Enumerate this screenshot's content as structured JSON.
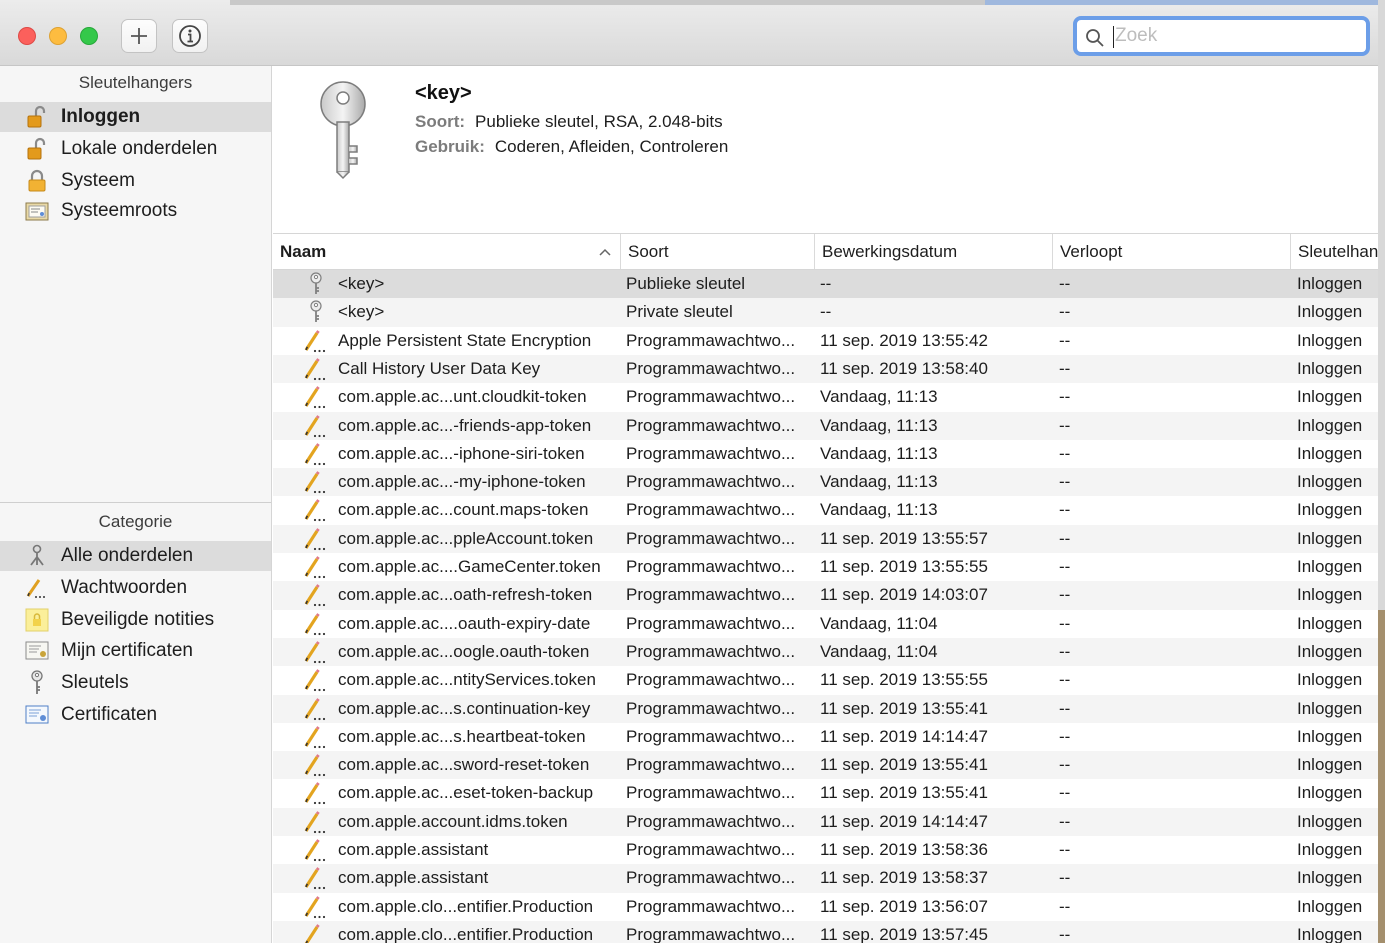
{
  "toolbar": {
    "add_icon": "plus-icon",
    "info_icon": "info-icon",
    "search": {
      "placeholder": "Zoek",
      "value": ""
    }
  },
  "sidebar": {
    "keychains_header": "Sleutelhangers",
    "keychains": [
      {
        "label": "Inloggen",
        "icon": "unlocked-padlock-icon",
        "selected": true
      },
      {
        "label": "Lokale onderdelen",
        "icon": "unlocked-padlock-icon"
      },
      {
        "label": "Systeem",
        "icon": "locked-padlock-icon"
      },
      {
        "label": "Systeemroots",
        "icon": "certificate-folder-icon"
      }
    ],
    "category_header": "Categorie",
    "categories": [
      {
        "label": "Alle onderdelen",
        "icon": "all-items-icon",
        "selected": true
      },
      {
        "label": "Wachtwoorden",
        "icon": "password-pencil-icon"
      },
      {
        "label": "Beveiligde notities",
        "icon": "secure-note-icon"
      },
      {
        "label": "Mijn certificaten",
        "icon": "my-certificate-icon"
      },
      {
        "label": "Sleutels",
        "icon": "key-icon"
      },
      {
        "label": "Certificaten",
        "icon": "certificate-icon"
      }
    ]
  },
  "detail": {
    "title": "<key>",
    "kind_label": "Soort:",
    "kind_value": "Publieke sleutel, RSA, 2.048-bits",
    "usage_label": "Gebruik:",
    "usage_value": "Coderen, Afleiden, Controleren"
  },
  "table": {
    "columns": [
      "Naam",
      "Soort",
      "Bewerkingsdatum",
      "Verloopt",
      "Sleutelhanger"
    ],
    "rows": [
      {
        "icon": "key",
        "name": "<key>",
        "kind": "Publieke sleutel",
        "date": "--",
        "expires": "--",
        "keychain": "Inloggen"
      },
      {
        "icon": "key",
        "name": "<key>",
        "kind": "Private sleutel",
        "date": "--",
        "expires": "--",
        "keychain": "Inloggen"
      },
      {
        "icon": "pencil",
        "name": "Apple Persistent State Encryption",
        "kind": "Programmawachtwo...",
        "date": "11 sep. 2019 13:55:42",
        "expires": "--",
        "keychain": "Inloggen"
      },
      {
        "icon": "pencil",
        "name": "Call History User Data Key",
        "kind": "Programmawachtwo...",
        "date": "11 sep. 2019 13:58:40",
        "expires": "--",
        "keychain": "Inloggen"
      },
      {
        "icon": "pencil",
        "name": "com.apple.ac...unt.cloudkit-token",
        "kind": "Programmawachtwo...",
        "date": "Vandaag, 11:13",
        "expires": "--",
        "keychain": "Inloggen"
      },
      {
        "icon": "pencil",
        "name": "com.apple.ac...-friends-app-token",
        "kind": "Programmawachtwo...",
        "date": "Vandaag, 11:13",
        "expires": "--",
        "keychain": "Inloggen"
      },
      {
        "icon": "pencil",
        "name": "com.apple.ac...-iphone-siri-token",
        "kind": "Programmawachtwo...",
        "date": "Vandaag, 11:13",
        "expires": "--",
        "keychain": "Inloggen"
      },
      {
        "icon": "pencil",
        "name": "com.apple.ac...-my-iphone-token",
        "kind": "Programmawachtwo...",
        "date": "Vandaag, 11:13",
        "expires": "--",
        "keychain": "Inloggen"
      },
      {
        "icon": "pencil",
        "name": "com.apple.ac...count.maps-token",
        "kind": "Programmawachtwo...",
        "date": "Vandaag, 11:13",
        "expires": "--",
        "keychain": "Inloggen"
      },
      {
        "icon": "pencil",
        "name": "com.apple.ac...ppleAccount.token",
        "kind": "Programmawachtwo...",
        "date": "11 sep. 2019 13:55:57",
        "expires": "--",
        "keychain": "Inloggen"
      },
      {
        "icon": "pencil",
        "name": "com.apple.ac....GameCenter.token",
        "kind": "Programmawachtwo...",
        "date": "11 sep. 2019 13:55:55",
        "expires": "--",
        "keychain": "Inloggen"
      },
      {
        "icon": "pencil",
        "name": "com.apple.ac...oath-refresh-token",
        "kind": "Programmawachtwo...",
        "date": "11 sep. 2019 14:03:07",
        "expires": "--",
        "keychain": "Inloggen"
      },
      {
        "icon": "pencil",
        "name": "com.apple.ac....oauth-expiry-date",
        "kind": "Programmawachtwo...",
        "date": "Vandaag, 11:04",
        "expires": "--",
        "keychain": "Inloggen"
      },
      {
        "icon": "pencil",
        "name": "com.apple.ac...oogle.oauth-token",
        "kind": "Programmawachtwo...",
        "date": "Vandaag, 11:04",
        "expires": "--",
        "keychain": "Inloggen"
      },
      {
        "icon": "pencil",
        "name": "com.apple.ac...ntityServices.token",
        "kind": "Programmawachtwo...",
        "date": "11 sep. 2019 13:55:55",
        "expires": "--",
        "keychain": "Inloggen"
      },
      {
        "icon": "pencil",
        "name": "com.apple.ac...s.continuation-key",
        "kind": "Programmawachtwo...",
        "date": "11 sep. 2019 13:55:41",
        "expires": "--",
        "keychain": "Inloggen"
      },
      {
        "icon": "pencil",
        "name": "com.apple.ac...s.heartbeat-token",
        "kind": "Programmawachtwo...",
        "date": "11 sep. 2019 14:14:47",
        "expires": "--",
        "keychain": "Inloggen"
      },
      {
        "icon": "pencil",
        "name": "com.apple.ac...sword-reset-token",
        "kind": "Programmawachtwo...",
        "date": "11 sep. 2019 13:55:41",
        "expires": "--",
        "keychain": "Inloggen"
      },
      {
        "icon": "pencil",
        "name": "com.apple.ac...eset-token-backup",
        "kind": "Programmawachtwo...",
        "date": "11 sep. 2019 13:55:41",
        "expires": "--",
        "keychain": "Inloggen"
      },
      {
        "icon": "pencil",
        "name": "com.apple.account.idms.token",
        "kind": "Programmawachtwo...",
        "date": "11 sep. 2019 14:14:47",
        "expires": "--",
        "keychain": "Inloggen"
      },
      {
        "icon": "pencil",
        "name": "com.apple.assistant",
        "kind": "Programmawachtwo...",
        "date": "11 sep. 2019 13:58:36",
        "expires": "--",
        "keychain": "Inloggen"
      },
      {
        "icon": "pencil",
        "name": "com.apple.assistant",
        "kind": "Programmawachtwo...",
        "date": "11 sep. 2019 13:58:37",
        "expires": "--",
        "keychain": "Inloggen"
      },
      {
        "icon": "pencil",
        "name": "com.apple.clo...entifier.Production",
        "kind": "Programmawachtwo...",
        "date": "11 sep. 2019 13:56:07",
        "expires": "--",
        "keychain": "Inloggen"
      },
      {
        "icon": "pencil",
        "name": "com.apple.clo...entifier.Production",
        "kind": "Programmawachtwo...",
        "date": "11 sep. 2019 13:57:45",
        "expires": "--",
        "keychain": "Inloggen"
      }
    ]
  },
  "colors": {
    "selection": "#dcdcdc",
    "search_focus": "#6c9ee8",
    "close": "#fc605c",
    "minimize": "#fdbc40",
    "zoom": "#34c84a"
  }
}
